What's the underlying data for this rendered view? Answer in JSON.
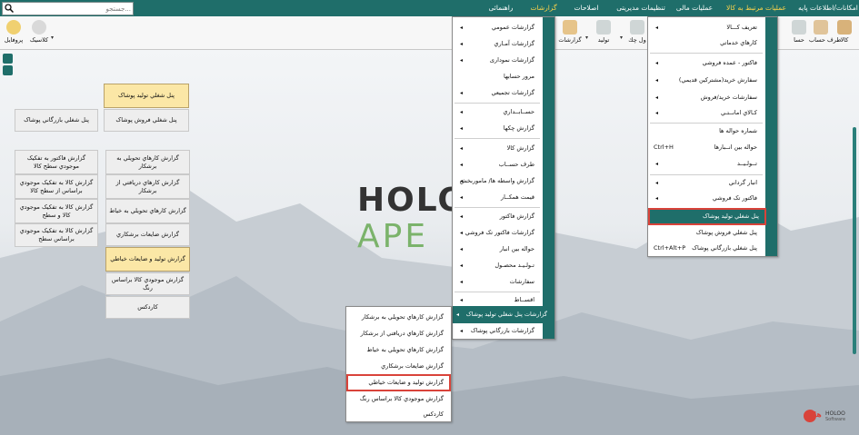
{
  "menubar": {
    "items": [
      {
        "label": "امکانات/اطلاعات پایه",
        "active": false
      },
      {
        "label": "عملیات مرتبط به کالا",
        "active": false
      },
      {
        "label": "عملیات مالی",
        "active": false
      },
      {
        "label": "تنظیمات مدیریتی",
        "active": false
      },
      {
        "label": "اصلاحات",
        "active": false
      },
      {
        "label": "گزارشات",
        "active": true
      },
      {
        "label": "راهنمائی",
        "active": false
      }
    ],
    "search_placeholder": "جستجو..."
  },
  "toolbar": {
    "items": [
      "کالا",
      "طرف حساب",
      "حسا",
      "ثبت چک",
      "تولید",
      "گزارشات",
      "کلاسیک",
      "پروفایل"
    ],
    "partial_label": "ول چك"
  },
  "panels": {
    "col1": [
      "پنل شغلي توليد پوشاک",
      "پنل شغلي فروش پوشاک"
    ],
    "col1_highlight": 0,
    "col2_top": "پنل شغلي بازرگاني پوشاک",
    "col3": [
      "گزارش کارهاي تحويلي به برشکار",
      "گزارش کارهاي دريافتي از برشکار",
      "گزارش کارهاي تحويلي به خياط",
      "گزارش ضايعات برشکاري",
      "گزارش توليد و ضايعات خياطي",
      "گزارش موجودي کالا براساس رنگ",
      "کاردکس"
    ],
    "col3_highlight": 4,
    "col4": [
      "گزارش فاکتور به تفکيک موجودي سطح کالا",
      "گزارش کالا به تفکيک موجودي براساس از سطح کالا",
      "گزارش کالا به تفکيک موجودي کالا و سطح",
      "گزارش کالا به تفکيک موجودي براساس سطح"
    ]
  },
  "menu_goods": {
    "items": [
      {
        "label": "تعريف کـــالا",
        "sub": true
      },
      {
        "label": "کارهاي خدماتي",
        "sub": false
      },
      {
        "label": "فاکتور - عمده فروشي",
        "sub": true
      },
      {
        "label": "سفارش خريد(مشترکين قديمي)",
        "sub": true
      },
      {
        "label": "سفارشات خريد/فروش",
        "sub": true
      },
      {
        "label": "کـالاي امانــتـي",
        "sub": true
      },
      {
        "label": "شماره حواله ها",
        "sub": false
      },
      {
        "label": "حواله بين انــبارها",
        "sub": false,
        "shortcut": "Ctrl+H"
      },
      {
        "label": "تــولـيــد",
        "sub": true
      },
      {
        "label": "انبار گرداني",
        "sub": true
      },
      {
        "label": "فاکتور تک فروشي",
        "sub": true
      },
      {
        "label": "پنل شغلي توليد پوشاک",
        "sub": false,
        "selected": true
      },
      {
        "label": "پنل شغلي فروش پوشاک",
        "sub": false
      },
      {
        "label": "پنل شغلي بازرگاني پوشاک",
        "sub": false,
        "shortcut": "Ctrl+Alt+P"
      }
    ]
  },
  "menu_reports": {
    "items": [
      {
        "label": "گزارشات عمومي",
        "sub": true
      },
      {
        "label": "گزارشات آمـاري",
        "sub": true
      },
      {
        "label": "گزارشات نمودارى",
        "sub": true
      },
      {
        "label": "مرور حسابها",
        "sub": false
      },
      {
        "label": "گزارشات تجميعي",
        "sub": true
      },
      {
        "label": "حســابــداري",
        "sub": true
      },
      {
        "label": "گزارش چکها",
        "sub": true
      },
      {
        "label": "گزارش کالا",
        "sub": true
      },
      {
        "label": "طرف حســاب",
        "sub": true
      },
      {
        "label": "گزارش واسطه ها/ ماموربخش",
        "sub": true
      },
      {
        "label": "قيمت همکــار",
        "sub": true
      },
      {
        "label": "گزارش فاكتور",
        "sub": true
      },
      {
        "label": "گزارشات فاكتور تک فروشي",
        "sub": true
      },
      {
        "label": "حواله بين انبار",
        "sub": true
      },
      {
        "label": "تـولـيـد محصـول",
        "sub": true
      },
      {
        "label": "سفارشات",
        "sub": true
      },
      {
        "label": "اقســاط",
        "sub": true
      },
      {
        "label": "گزارشات پنل شغلي توليد پوشاک",
        "sub": true,
        "selected": true
      },
      {
        "label": "گزارشات بازرگاني پوشاک",
        "sub": true
      }
    ]
  },
  "menu_prod_reports": {
    "items": [
      {
        "label": "گزارش کارهاي تحويلي به برشکار"
      },
      {
        "label": "گزارش کارهاي دريافتي از برشکار"
      },
      {
        "label": "گزارش کارهاي تحويلي به خياط"
      },
      {
        "label": "گزارش ضايعات برشکاري"
      },
      {
        "label": "گزارش توليد و ضايعات خياطي",
        "highlight": true
      },
      {
        "label": "گزارش موجودي کالا براساس رنگ"
      },
      {
        "label": "کاردکس"
      }
    ]
  },
  "logo": {
    "text": "HOLO",
    "subtext": "APE",
    "brand_text": "هلو",
    "brand_sub": "HOLOO",
    "brand_sub2": "Software"
  },
  "colors": {
    "accent": "#1f6e6a",
    "highlight_red": "#d9433a",
    "active_menu": "#ffd54a",
    "panel_highlight": "#fbe7a6"
  }
}
